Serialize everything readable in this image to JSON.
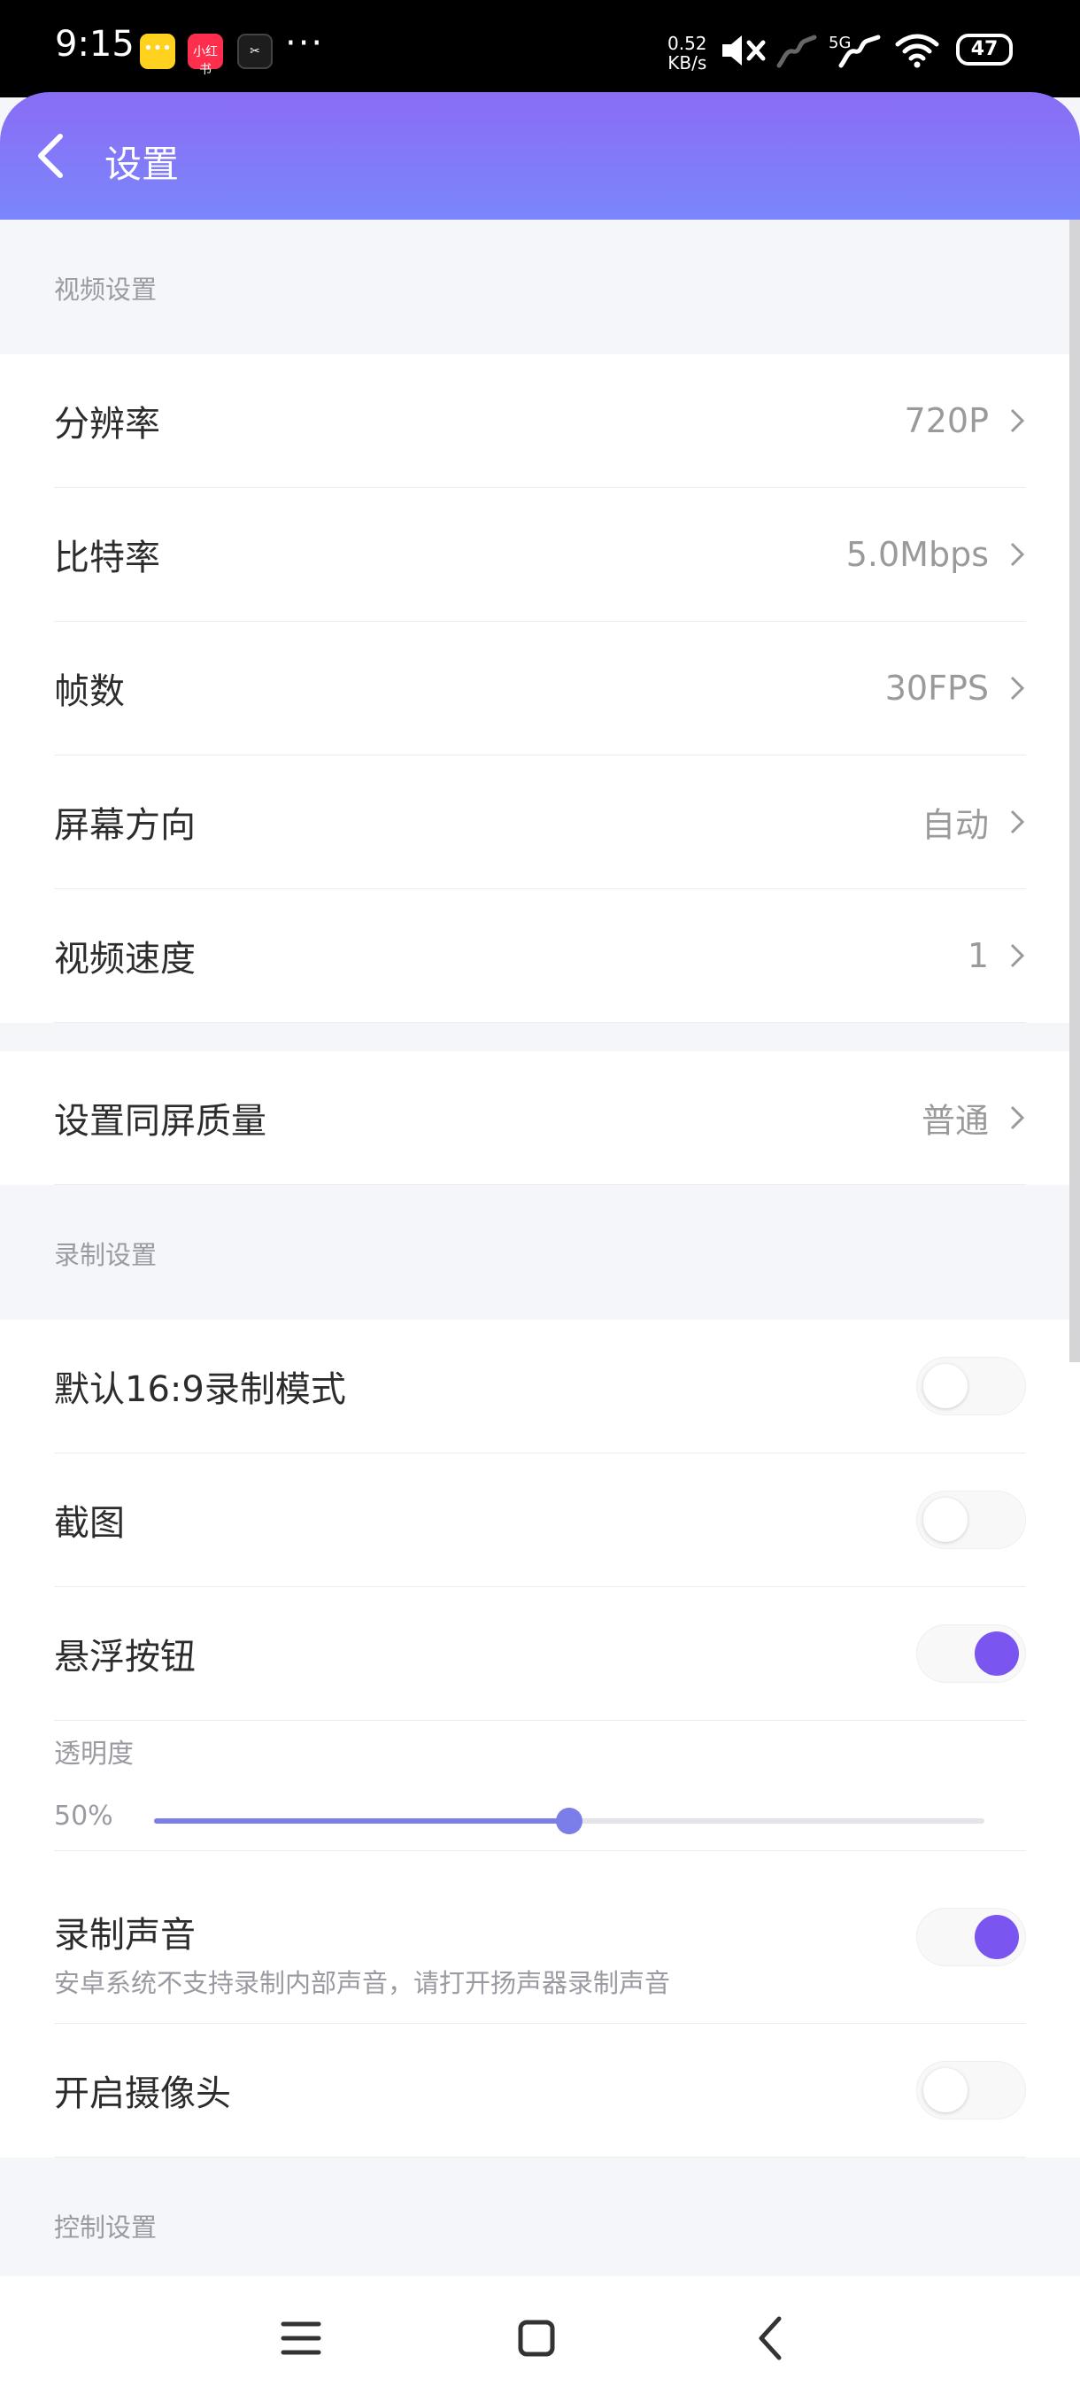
{
  "status_bar": {
    "time": "9:15",
    "app_icons": [
      "chat-app-icon",
      "xiaohongshu-icon",
      "capcut-icon"
    ],
    "app2_label": "小红书",
    "more": "···",
    "net_speed_value": "0.52",
    "net_speed_unit": "KB/s",
    "network_label": "5G",
    "battery": "47"
  },
  "app_bar": {
    "title": "设置"
  },
  "video_settings": {
    "header": "视频设置",
    "items": [
      {
        "label": "分辨率",
        "value": "720P"
      },
      {
        "label": "比特率",
        "value": "5.0Mbps"
      },
      {
        "label": "帧数",
        "value": "30FPS"
      },
      {
        "label": "屏幕方向",
        "value": "自动"
      },
      {
        "label": "视频速度",
        "value": "1"
      }
    ]
  },
  "mirror": {
    "label": "设置同屏质量",
    "value": "普通"
  },
  "record_settings": {
    "header": "录制设置",
    "default_169": {
      "label": "默认16:9录制模式",
      "on": false
    },
    "screenshot": {
      "label": "截图",
      "on": false
    },
    "floating_button": {
      "label": "悬浮按钮",
      "on": true
    },
    "opacity": {
      "label": "透明度",
      "value_text": "50%",
      "value": 0.5
    },
    "record_audio": {
      "label": "录制声音",
      "hint": "安卓系统不支持录制内部声音，请打开扬声器录制声音",
      "on": true
    },
    "camera": {
      "label": "开启摄像头",
      "on": false
    }
  },
  "control_settings": {
    "header": "控制设置"
  },
  "colors": {
    "accent": "#7b55f0",
    "header_gradient_start": "#8a6cf5",
    "header_gradient_end": "#7b86fb",
    "slider": "#7b7ee8"
  }
}
